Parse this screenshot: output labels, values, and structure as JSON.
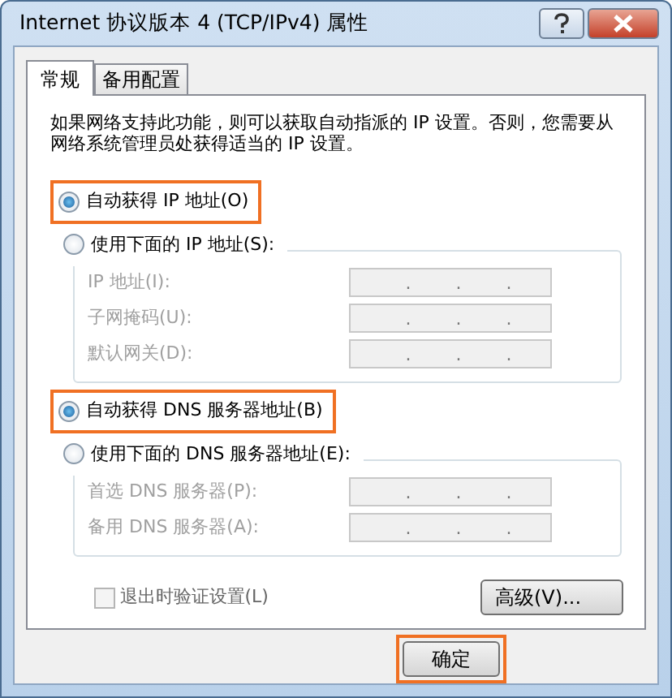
{
  "window": {
    "title": "Internet 协议版本 4 (TCP/IPv4) 属性"
  },
  "tabs": [
    {
      "label": "常规",
      "selected": true
    },
    {
      "label": "备用配置",
      "selected": false
    }
  ],
  "description": "如果网络支持此功能，则可以获取自动指派的 IP 设置。否则，您需要从网络系统管理员处获得适当的 IP 设置。",
  "ip_section": {
    "options": [
      {
        "label": "自动获得 IP 地址(O)",
        "selected": true,
        "highlighted": true
      },
      {
        "label": "使用下面的 IP 地址(S):",
        "selected": false,
        "highlighted": false
      }
    ],
    "fields": [
      {
        "label": "IP 地址(I):",
        "disabled": true,
        "dots": [
          ".",
          ".",
          "."
        ]
      },
      {
        "label": "子网掩码(U):",
        "disabled": true,
        "dots": [
          ".",
          ".",
          "."
        ]
      },
      {
        "label": "默认网关(D):",
        "disabled": true,
        "dots": [
          ".",
          ".",
          "."
        ]
      }
    ]
  },
  "dns_section": {
    "options": [
      {
        "label": "自动获得 DNS 服务器地址(B)",
        "selected": true,
        "highlighted": true
      },
      {
        "label": "使用下面的 DNS 服务器地址(E):",
        "selected": false,
        "highlighted": false
      }
    ],
    "fields": [
      {
        "label": "首选 DNS 服务器(P):",
        "disabled": true,
        "dots": [
          ".",
          ".",
          "."
        ]
      },
      {
        "label": "备用 DNS 服务器(A):",
        "disabled": true,
        "dots": [
          ".",
          ".",
          "."
        ]
      }
    ]
  },
  "validate_checkbox": {
    "label": "退出时验证设置(L)",
    "checked": false,
    "disabled": true
  },
  "advanced_button": "高级(V)...",
  "ok_button": {
    "label": "确定",
    "highlighted": true
  }
}
